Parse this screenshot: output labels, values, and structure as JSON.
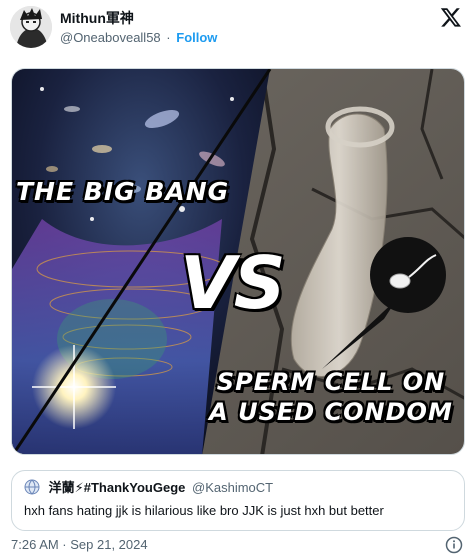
{
  "tweet": {
    "display_name": "Mithun軍神",
    "handle": "@Oneaboveall58",
    "separator": "·",
    "follow_label": "Follow",
    "timestamp": "7:26 AM · Sep 21, 2024"
  },
  "media": {
    "left_caption": "THE BIG BANG",
    "center_caption": "VS",
    "right_caption": "SPERM CELL ON A USED CONDOM"
  },
  "quote": {
    "display_name": "洋蘭⚡#ThankYouGege",
    "handle": "@KashimoCT",
    "text": "hxh fans hating jjk is hilarious like bro JJK is just hxh but better"
  },
  "icons": {
    "x_logo": "x-logo-icon",
    "info": "info-icon",
    "avatar": "avatar",
    "quote_avatar": "globe-icon"
  },
  "colors": {
    "link": "#1d9bf0",
    "secondary_text": "#536471",
    "border": "#cfd9de"
  }
}
